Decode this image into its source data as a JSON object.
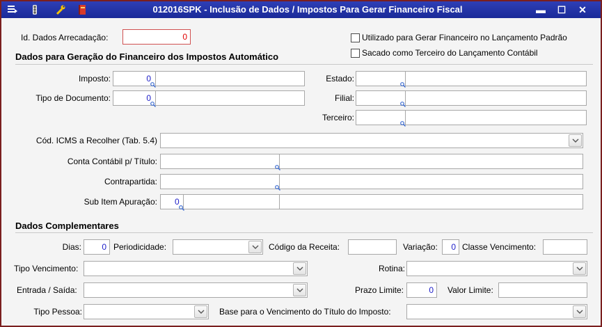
{
  "window": {
    "title": "012016SPK - Inclusão de Dados / Impostos  Para Gerar Financeiro Fiscal",
    "toolbar_icons": [
      "save-list-icon",
      "traffic-light-icon",
      "wrench-icon",
      "book-icon"
    ],
    "controls": {
      "minimize": "▬",
      "maximize": "☐",
      "close": "✕"
    }
  },
  "id_dados": {
    "label": "Id. Dados Arrecadação:",
    "value": "0"
  },
  "checkboxes": {
    "gerar_financeiro": {
      "label": "Utilizado para Gerar Financeiro no Lançamento Padrão",
      "checked": false
    },
    "sacado_terceiro": {
      "label": "Sacado como Terceiro do Lançamento Contábil",
      "checked": false
    }
  },
  "section_auto": {
    "title": "Dados para Geração do Financeiro dos Impostos Automático",
    "imposto": {
      "label": "Imposto:",
      "value": "0"
    },
    "tipo_documento": {
      "label": "Tipo de Documento:",
      "value": "0"
    },
    "estado": {
      "label": "Estado:",
      "value": ""
    },
    "filial": {
      "label": "Filial:",
      "value": ""
    },
    "terceiro": {
      "label": "Terceiro:",
      "value": ""
    },
    "cod_icms": {
      "label": "Cód. ICMS a Recolher (Tab. 5.4)",
      "value": ""
    },
    "conta_contabil": {
      "label": "Conta Contábil p/ Título:",
      "value": ""
    },
    "contrapartida": {
      "label": "Contrapartida:",
      "value": ""
    },
    "sub_item": {
      "label": "Sub Item Apuração:",
      "value": "0"
    }
  },
  "section_comp": {
    "title": "Dados Complementares",
    "dias": {
      "label": "Dias:",
      "value": "0"
    },
    "periodicidade": {
      "label": "Periodicidade:",
      "value": ""
    },
    "codigo_receita": {
      "label": "Código da Receita:",
      "value": ""
    },
    "variacao": {
      "label": "Variação:",
      "value": "0"
    },
    "classe_vencimento": {
      "label": "Classe Vencimento:",
      "value": ""
    },
    "tipo_vencimento": {
      "label": "Tipo Vencimento:",
      "value": ""
    },
    "rotina": {
      "label": "Rotina:",
      "value": ""
    },
    "entrada_saida": {
      "label": "Entrada / Saída:",
      "value": ""
    },
    "prazo_limite": {
      "label": "Prazo Limite:",
      "value": "0"
    },
    "valor_limite": {
      "label": "Valor Limite:",
      "value": ""
    },
    "tipo_pessoa": {
      "label": "Tipo Pessoa:",
      "value": ""
    },
    "base_vencimento": {
      "label": "Base para o Vencimento do Título do Imposto:",
      "value": ""
    }
  },
  "colors": {
    "title_bar": "#1f2fa6",
    "frame": "#7a1f1f",
    "value_blue": "#1c1cc8",
    "value_red": "#e00000"
  }
}
